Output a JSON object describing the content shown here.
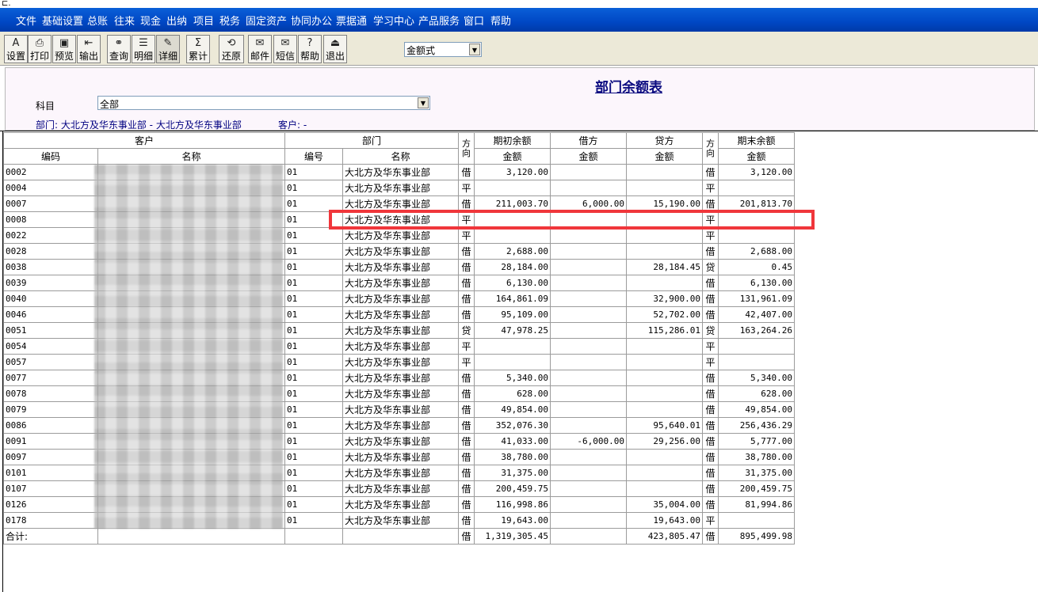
{
  "menu": [
    "文件",
    "基础设置",
    "总账",
    "往来",
    "现金",
    "出纳",
    "项目",
    "税务",
    "固定资产",
    "协同办公",
    "票据通",
    "学习中心",
    "产品服务",
    "窗口",
    "帮助"
  ],
  "toolbar": {
    "buttons": [
      {
        "label": "设置",
        "icon": "settings-icon"
      },
      {
        "label": "打印",
        "icon": "printer-icon"
      },
      {
        "label": "预览",
        "icon": "preview-icon"
      },
      {
        "label": "输出",
        "icon": "export-icon"
      },
      {
        "label": "查询",
        "icon": "binoculars-icon"
      },
      {
        "label": "明细",
        "icon": "detail-icon"
      },
      {
        "label": "详细",
        "icon": "expand-icon"
      },
      {
        "label": "累计",
        "icon": "sigma-icon"
      },
      {
        "label": "还原",
        "icon": "restore-icon"
      },
      {
        "label": "邮件",
        "icon": "mail-icon"
      },
      {
        "label": "短信",
        "icon": "sms-icon"
      },
      {
        "label": "帮助",
        "icon": "help-icon"
      },
      {
        "label": "退出",
        "icon": "exit-icon"
      }
    ],
    "format_select": "金额式"
  },
  "report": {
    "title": "部门余额表",
    "subject_label": "科目",
    "subject_value": "全部",
    "dept_info": "部门: 大北方及华东事业部 - 大北方及华东事业部",
    "customer_info": "客户: -"
  },
  "columns": {
    "customer": "客户",
    "code": "编码",
    "name": "名称",
    "dept": "部门",
    "dept_code": "编号",
    "dept_name": "名称",
    "dir": "方向",
    "opening": "期初余额",
    "debit": "借方",
    "credit": "贷方",
    "dir2": "方向",
    "closing": "期末余额",
    "amount": "金额"
  },
  "rows": [
    {
      "code": "0002",
      "dept_code": "01",
      "dept": "大北方及华东事业部",
      "dir": "借",
      "open": "3,120.00",
      "debit": "",
      "credit": "",
      "dir2": "借",
      "close": "3,120.00"
    },
    {
      "code": "0004",
      "dept_code": "01",
      "dept": "大北方及华东事业部",
      "dir": "平",
      "open": "",
      "debit": "",
      "credit": "",
      "dir2": "平",
      "close": ""
    },
    {
      "code": "0007",
      "dept_code": "01",
      "dept": "大北方及华东事业部",
      "dir": "借",
      "open": "211,003.70",
      "debit": "6,000.00",
      "credit": "15,190.00",
      "dir2": "借",
      "close": "201,813.70"
    },
    {
      "code": "0008",
      "dept_code": "01",
      "dept": "大北方及华东事业部",
      "dir": "平",
      "open": "",
      "debit": "",
      "credit": "",
      "dir2": "平",
      "close": ""
    },
    {
      "code": "0022",
      "dept_code": "01",
      "dept": "大北方及华东事业部",
      "dir": "平",
      "open": "",
      "debit": "",
      "credit": "",
      "dir2": "平",
      "close": ""
    },
    {
      "code": "0028",
      "dept_code": "01",
      "dept": "大北方及华东事业部",
      "dir": "借",
      "open": "2,688.00",
      "debit": "",
      "credit": "",
      "dir2": "借",
      "close": "2,688.00"
    },
    {
      "code": "0038",
      "dept_code": "01",
      "dept": "大北方及华东事业部",
      "dir": "借",
      "open": "28,184.00",
      "debit": "",
      "credit": "28,184.45",
      "dir2": "贷",
      "close": "0.45"
    },
    {
      "code": "0039",
      "dept_code": "01",
      "dept": "大北方及华东事业部",
      "dir": "借",
      "open": "6,130.00",
      "debit": "",
      "credit": "",
      "dir2": "借",
      "close": "6,130.00"
    },
    {
      "code": "0040",
      "dept_code": "01",
      "dept": "大北方及华东事业部",
      "dir": "借",
      "open": "164,861.09",
      "debit": "",
      "credit": "32,900.00",
      "dir2": "借",
      "close": "131,961.09"
    },
    {
      "code": "0046",
      "dept_code": "01",
      "dept": "大北方及华东事业部",
      "dir": "借",
      "open": "95,109.00",
      "debit": "",
      "credit": "52,702.00",
      "dir2": "借",
      "close": "42,407.00"
    },
    {
      "code": "0051",
      "dept_code": "01",
      "dept": "大北方及华东事业部",
      "dir": "贷",
      "open": "47,978.25",
      "debit": "",
      "credit": "115,286.01",
      "dir2": "贷",
      "close": "163,264.26"
    },
    {
      "code": "0054",
      "dept_code": "01",
      "dept": "大北方及华东事业部",
      "dir": "平",
      "open": "",
      "debit": "",
      "credit": "",
      "dir2": "平",
      "close": ""
    },
    {
      "code": "0057",
      "dept_code": "01",
      "dept": "大北方及华东事业部",
      "dir": "平",
      "open": "",
      "debit": "",
      "credit": "",
      "dir2": "平",
      "close": ""
    },
    {
      "code": "0077",
      "dept_code": "01",
      "dept": "大北方及华东事业部",
      "dir": "借",
      "open": "5,340.00",
      "debit": "",
      "credit": "",
      "dir2": "借",
      "close": "5,340.00"
    },
    {
      "code": "0078",
      "dept_code": "01",
      "dept": "大北方及华东事业部",
      "dir": "借",
      "open": "628.00",
      "debit": "",
      "credit": "",
      "dir2": "借",
      "close": "628.00"
    },
    {
      "code": "0079",
      "dept_code": "01",
      "dept": "大北方及华东事业部",
      "dir": "借",
      "open": "49,854.00",
      "debit": "",
      "credit": "",
      "dir2": "借",
      "close": "49,854.00"
    },
    {
      "code": "0086",
      "dept_code": "01",
      "dept": "大北方及华东事业部",
      "dir": "借",
      "open": "352,076.30",
      "debit": "",
      "credit": "95,640.01",
      "dir2": "借",
      "close": "256,436.29"
    },
    {
      "code": "0091",
      "dept_code": "01",
      "dept": "大北方及华东事业部",
      "dir": "借",
      "open": "41,033.00",
      "debit": "-6,000.00",
      "credit": "29,256.00",
      "dir2": "借",
      "close": "5,777.00"
    },
    {
      "code": "0097",
      "dept_code": "01",
      "dept": "大北方及华东事业部",
      "dir": "借",
      "open": "38,780.00",
      "debit": "",
      "credit": "",
      "dir2": "借",
      "close": "38,780.00"
    },
    {
      "code": "0101",
      "dept_code": "01",
      "dept": "大北方及华东事业部",
      "dir": "借",
      "open": "31,375.00",
      "debit": "",
      "credit": "",
      "dir2": "借",
      "close": "31,375.00"
    },
    {
      "code": "0107",
      "dept_code": "01",
      "dept": "大北方及华东事业部",
      "dir": "借",
      "open": "200,459.75",
      "debit": "",
      "credit": "",
      "dir2": "借",
      "close": "200,459.75"
    },
    {
      "code": "0126",
      "dept_code": "01",
      "dept": "大北方及华东事业部",
      "dir": "借",
      "open": "116,998.86",
      "debit": "",
      "credit": "35,004.00",
      "dir2": "借",
      "close": "81,994.86"
    },
    {
      "code": "0178",
      "dept_code": "01",
      "dept": "大北方及华东事业部",
      "dir": "借",
      "open": "19,643.00",
      "debit": "",
      "credit": "19,643.00",
      "dir2": "平",
      "close": ""
    }
  ],
  "total": {
    "label": "合计:",
    "dir": "借",
    "open": "1,319,305.45",
    "debit": "",
    "credit": "423,805.47",
    "dir2": "借",
    "close": "895,499.98"
  },
  "colors": {
    "menubar": "#0047c4",
    "highlight": "#f0363b",
    "title": "#0b0b80"
  }
}
